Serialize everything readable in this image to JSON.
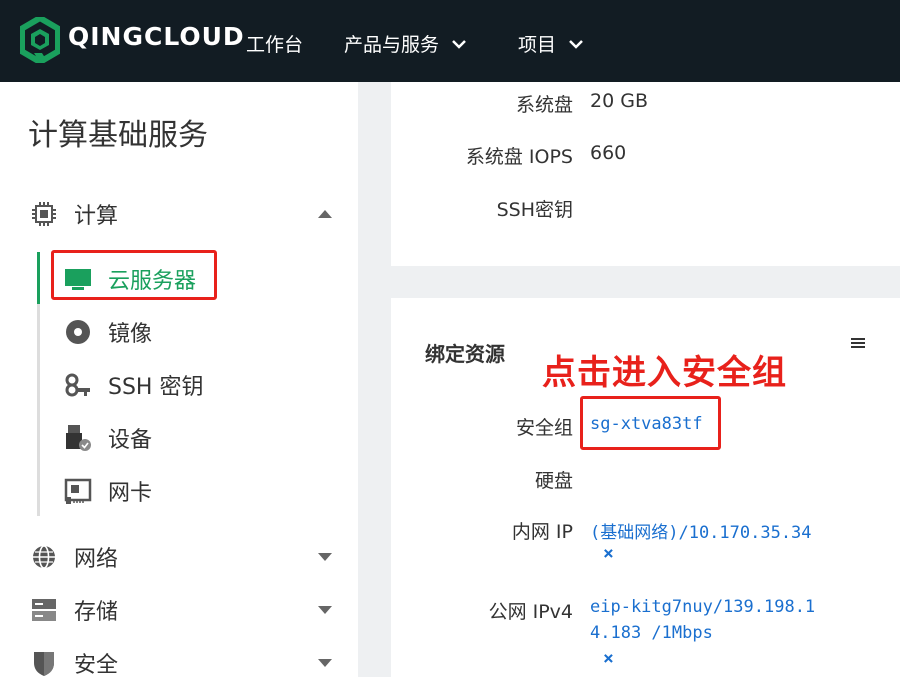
{
  "header": {
    "brand": "QINGCLOUD",
    "nav": [
      {
        "label": "工作台",
        "dropdown": false
      },
      {
        "label": "产品与服务",
        "dropdown": true
      },
      {
        "label": "项目",
        "dropdown": true
      }
    ],
    "logo_icon": "qingcloud-logo-icon"
  },
  "sidebar": {
    "title": "计算基础服务",
    "groups": [
      {
        "label": "计算",
        "icon": "chip-icon",
        "expanded": true
      },
      {
        "label": "网络",
        "icon": "globe-icon",
        "expanded": false
      },
      {
        "label": "存储",
        "icon": "storage-icon",
        "expanded": false
      },
      {
        "label": "安全",
        "icon": "shield-icon",
        "expanded": false
      }
    ],
    "compute_items": [
      {
        "label": "云服务器",
        "icon": "monitor-icon",
        "active": true
      },
      {
        "label": "镜像",
        "icon": "disc-icon",
        "active": false
      },
      {
        "label": "SSH 密钥",
        "icon": "key-icon",
        "active": false
      },
      {
        "label": "设备",
        "icon": "usb-device-icon",
        "active": false
      },
      {
        "label": "网卡",
        "icon": "nic-icon",
        "active": false
      }
    ]
  },
  "config_card": {
    "rows": [
      {
        "label": "系统盘",
        "value": "20 GB"
      },
      {
        "label": "系统盘 IOPS",
        "value": "660"
      },
      {
        "label": "SSH密钥",
        "value": ""
      }
    ]
  },
  "resources_card": {
    "title": "绑定资源",
    "security_group": {
      "label": "安全组",
      "value": "sg-xtva83tf"
    },
    "disk": {
      "label": "硬盘",
      "value": ""
    },
    "private_ip": {
      "label": "内网 IP",
      "line1": "(基础网络)/10.170.35.34",
      "remove": "×"
    },
    "public_ip": {
      "label": "公网 IPv4",
      "line1": "eip-kitg7nuy/139.198.1",
      "line2": "4.183 /1Mbps",
      "remove": "×"
    }
  },
  "annotation": "点击进入安全组",
  "colors": {
    "topbar": "#121c23",
    "accent_green": "#1aa05d",
    "link_blue": "#1a6fcf",
    "highlight_red": "#e8211b"
  }
}
